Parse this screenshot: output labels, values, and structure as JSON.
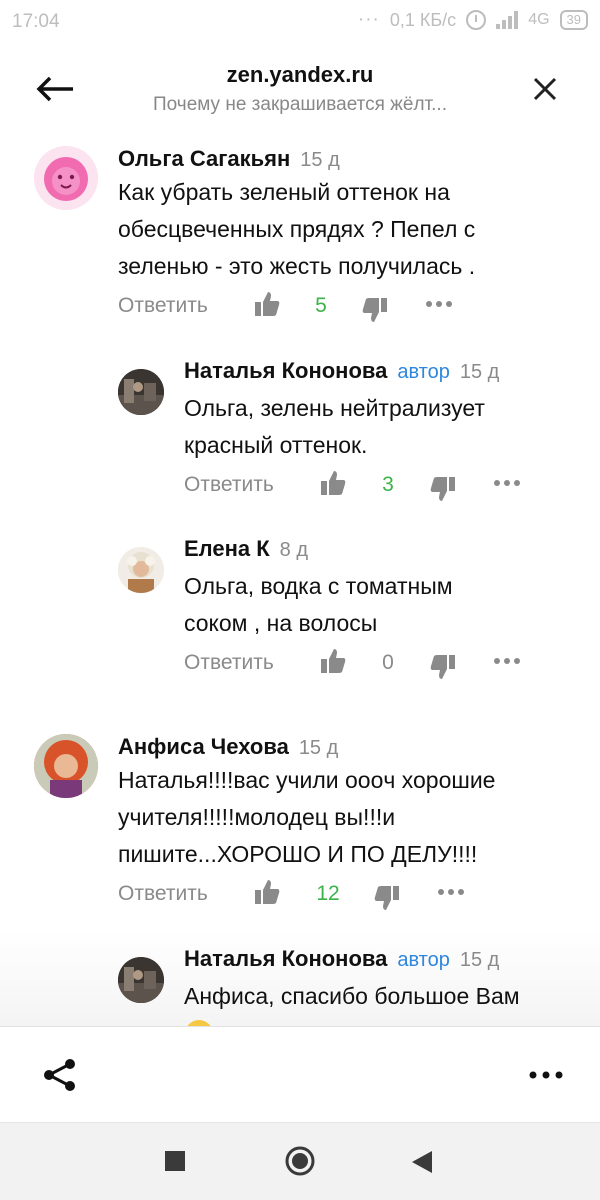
{
  "status_bar": {
    "time": "17:04",
    "network_speed": "0,1 КБ/с",
    "network_type": "4G",
    "battery": "39"
  },
  "header": {
    "site": "zen.yandex.ru",
    "subtitle": "Почему не закрашивается жёлт..."
  },
  "comments": [
    {
      "name": "Ольга Сагакьян",
      "date": "15 д",
      "text_lines": [
        "Как убрать зеленый оттенок на",
        "обесцвеченных прядях ? Пепел с",
        "зеленью - это жесть получилась ."
      ],
      "reply": "Ответить",
      "likes": "5"
    },
    {
      "name": "Наталья Кононова",
      "badge": "автор",
      "date": "15 д",
      "text_lines": [
        "Ольга, зелень нейтрализует",
        "красный оттенок."
      ],
      "reply": "Ответить",
      "likes": "3"
    },
    {
      "name": "Елена К",
      "date": "8 д",
      "text_lines": [
        "Ольга, водка с томатным",
        "соком , на волосы"
      ],
      "reply": "Ответить",
      "likes": "0"
    },
    {
      "name": "Анфиса Чехова",
      "date": "15 д",
      "text_lines": [
        "Наталья!!!!вас учили oooч хорошие",
        "учителя!!!!!молодец вы!!!и",
        "пишите...ХОРОШО И ПО ДЕЛУ!!!!"
      ],
      "reply": "Ответить",
      "likes": "12"
    },
    {
      "name": "Наталья Кононова",
      "badge": "автор",
      "date": "15 д",
      "text_lines": [
        "Анфиса, спасибо большое Вам"
      ]
    }
  ],
  "colors": {
    "accent_author": "#2e86de",
    "likes_green": "#3bb34a",
    "muted_gray": "#8a8a8a",
    "avatar_pink": "#f06bb0"
  }
}
